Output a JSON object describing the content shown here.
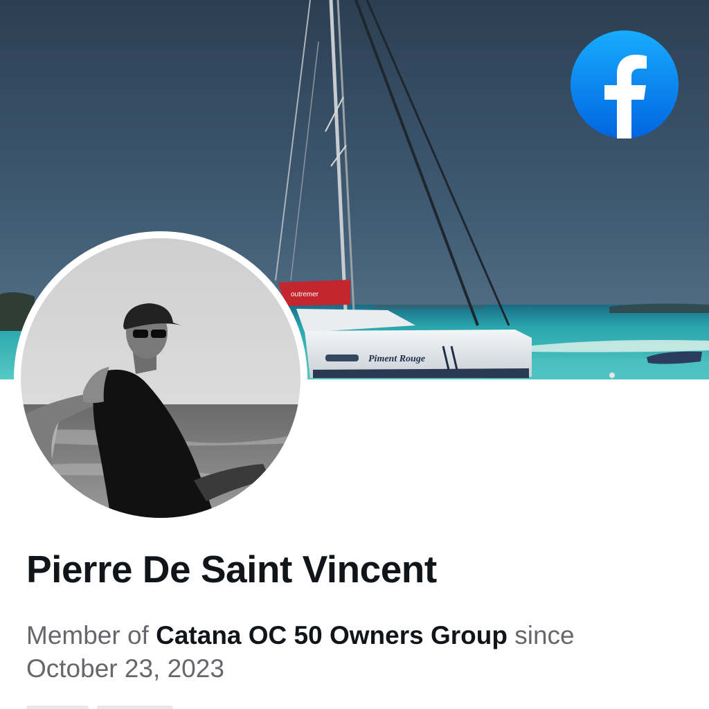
{
  "profile": {
    "name": "Pierre De Saint Vincent",
    "membership": {
      "prefix": "Member of ",
      "group": "Catana OC 50 Owners Group",
      "suffix": " since",
      "date": "October 23, 2023"
    }
  },
  "cover": {
    "boat_brand": "outremer",
    "boat_name": "Piment Rouge"
  },
  "icons": {
    "facebook": "facebook-logo-icon"
  },
  "colors": {
    "facebook_blue": "#1877f2",
    "name_text": "#111418",
    "secondary_text": "#65676b",
    "sky": "#3f5a73",
    "sea": "#33b0b0"
  }
}
